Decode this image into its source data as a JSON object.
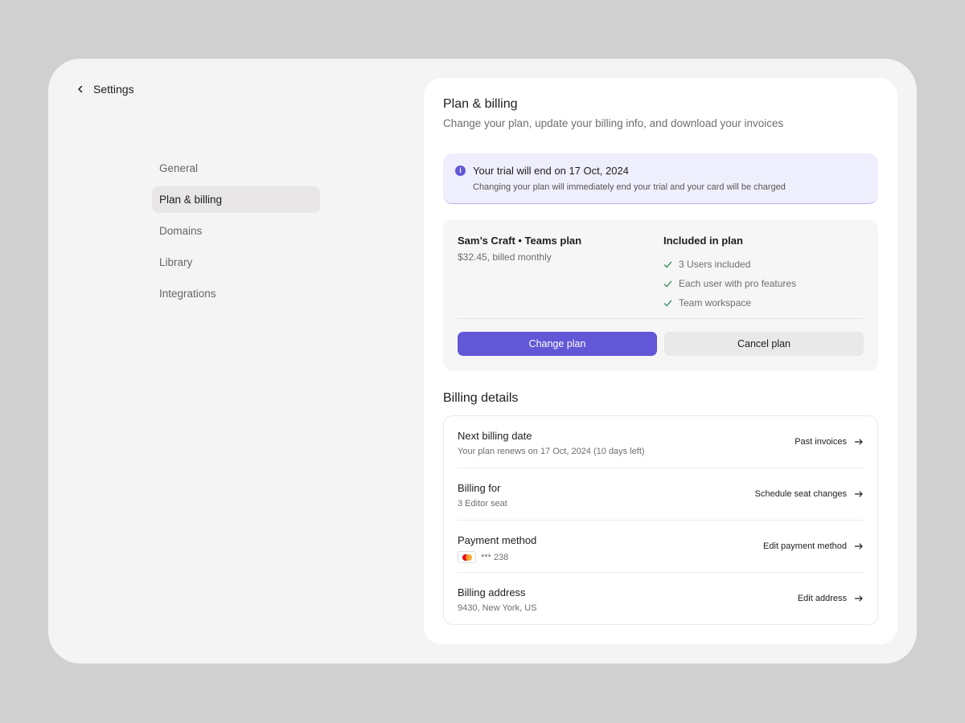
{
  "back": {
    "label": "Settings",
    "icon": "chevron-left-icon"
  },
  "nav": {
    "items": [
      {
        "label": "General"
      },
      {
        "label": "Plan & billing",
        "active": true
      },
      {
        "label": "Domains"
      },
      {
        "label": "Library"
      },
      {
        "label": "Integrations"
      }
    ]
  },
  "header": {
    "title": "Plan & billing",
    "subtitle": "Change your plan, update your billing info, and download your invoices"
  },
  "trial": {
    "icon": "info-icon",
    "title": "Your trial will end on 17 Oct, 2024",
    "description": "Changing your plan will immediately end your trial and your card will be charged"
  },
  "plan": {
    "name": "Sam’s Craft • Teams plan",
    "price": "$32.45, billed monthly",
    "included_title": "Included in plan",
    "features": [
      "3 Users included",
      "Each user with pro features",
      "Team workspace"
    ],
    "change_label": "Change plan",
    "cancel_label": "Cancel plan"
  },
  "billing": {
    "title": "Billing details",
    "rows": [
      {
        "title": "Next billing date",
        "sub": "Your plan renews on 17 Oct, 2024  (10 days left)",
        "action": "Past invoices"
      },
      {
        "title": "Billing for",
        "sub": "3 Editor seat",
        "action": "Schedule seat changes"
      },
      {
        "title": "Payment method",
        "sub": "*** 238",
        "action": "Edit payment method"
      },
      {
        "title": "Billing address",
        "sub": "9430, New York, US",
        "action": "Edit address"
      }
    ]
  },
  "colors": {
    "accent": "#6257d6",
    "trial_bg": "#efeefc",
    "check": "#2e8b57",
    "background": "#d0d0d0"
  }
}
